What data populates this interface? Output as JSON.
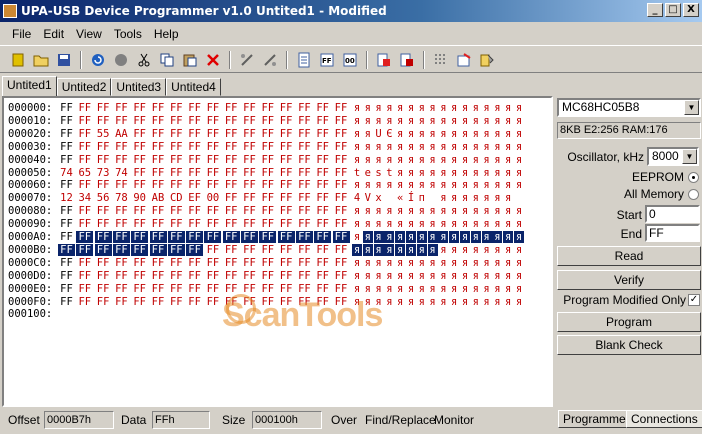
{
  "window": {
    "title": "UPA-USB Device Programmer v1.0  Untited1 - Modified",
    "min": "_",
    "max": "□",
    "close": "X"
  },
  "menu": [
    "File",
    "Edit",
    "View",
    "Tools",
    "Help"
  ],
  "tabs": [
    "Untited1",
    "Untited2",
    "Untited3",
    "Untited4"
  ],
  "editor": {
    "rows": [
      {
        "addr": "000000:",
        "bytes": [
          "FF",
          "FF",
          "FF",
          "FF",
          "FF",
          "FF",
          "FF",
          "FF",
          "FF",
          "FF",
          "FF",
          "FF",
          "FF",
          "FF",
          "FF",
          "FF"
        ],
        "chars": "яяяяяяяяяяяяяяяя"
      },
      {
        "addr": "000010:",
        "bytes": [
          "FF",
          "FF",
          "FF",
          "FF",
          "FF",
          "FF",
          "FF",
          "FF",
          "FF",
          "FF",
          "FF",
          "FF",
          "FF",
          "FF",
          "FF",
          "FF"
        ],
        "chars": "яяяяяяяяяяяяяяяя"
      },
      {
        "addr": "000020:",
        "bytes": [
          "FF",
          "FF",
          "55",
          "AA",
          "FF",
          "FF",
          "FF",
          "FF",
          "FF",
          "FF",
          "FF",
          "FF",
          "FF",
          "FF",
          "FF",
          "FF"
        ],
        "chars": "яяUЄяяяяяяяяяяяя"
      },
      {
        "addr": "000030:",
        "bytes": [
          "FF",
          "FF",
          "FF",
          "FF",
          "FF",
          "FF",
          "FF",
          "FF",
          "FF",
          "FF",
          "FF",
          "FF",
          "FF",
          "FF",
          "FF",
          "FF"
        ],
        "chars": "яяяяяяяяяяяяяяяя"
      },
      {
        "addr": "000040:",
        "bytes": [
          "FF",
          "FF",
          "FF",
          "FF",
          "FF",
          "FF",
          "FF",
          "FF",
          "FF",
          "FF",
          "FF",
          "FF",
          "FF",
          "FF",
          "FF",
          "FF"
        ],
        "chars": "яяяяяяяяяяяяяяяя"
      },
      {
        "addr": "000050:",
        "bytes": [
          "74",
          "65",
          "73",
          "74",
          "FF",
          "FF",
          "FF",
          "FF",
          "FF",
          "FF",
          "FF",
          "FF",
          "FF",
          "FF",
          "FF",
          "FF"
        ],
        "chars": "testяяяяяяяяяяяя"
      },
      {
        "addr": "000060:",
        "bytes": [
          "FF",
          "FF",
          "FF",
          "FF",
          "FF",
          "FF",
          "FF",
          "FF",
          "FF",
          "FF",
          "FF",
          "FF",
          "FF",
          "FF",
          "FF",
          "FF"
        ],
        "chars": "яяяяяяяяяяяяяяяя"
      },
      {
        "addr": "000070:",
        "bytes": [
          "12",
          "34",
          "56",
          "78",
          "90",
          "AB",
          "CD",
          "EF",
          "00",
          "FF",
          "FF",
          "FF",
          "FF",
          "FF",
          "FF",
          "FF"
        ],
        "chars": "4Vx«Íп яяяяяяя"
      },
      {
        "addr": "000080:",
        "bytes": [
          "FF",
          "FF",
          "FF",
          "FF",
          "FF",
          "FF",
          "FF",
          "FF",
          "FF",
          "FF",
          "FF",
          "FF",
          "FF",
          "FF",
          "FF",
          "FF"
        ],
        "chars": "яяяяяяяяяяяяяяяя"
      },
      {
        "addr": "000090:",
        "bytes": [
          "FF",
          "FF",
          "FF",
          "FF",
          "FF",
          "FF",
          "FF",
          "FF",
          "FF",
          "FF",
          "FF",
          "FF",
          "FF",
          "FF",
          "FF",
          "FF"
        ],
        "chars": "яяяяяяяяяяяяяяяя"
      },
      {
        "addr": "0000A0:",
        "bytes": [
          "FF",
          "FF",
          "FF",
          "FF",
          "FF",
          "FF",
          "FF",
          "FF",
          "FF",
          "FF",
          "FF",
          "FF",
          "FF",
          "FF",
          "FF",
          "FF"
        ],
        "chars": "яяяяяяяяяяяяяяяя"
      },
      {
        "addr": "0000B0:",
        "bytes": [
          "FF",
          "FF",
          "FF",
          "FF",
          "FF",
          "FF",
          "FF",
          "FF",
          "FF",
          "FF",
          "FF",
          "FF",
          "FF",
          "FF",
          "FF",
          "FF"
        ],
        "chars": "яяяяяяяяяяяяяяяя"
      },
      {
        "addr": "0000C0:",
        "bytes": [
          "FF",
          "FF",
          "FF",
          "FF",
          "FF",
          "FF",
          "FF",
          "FF",
          "FF",
          "FF",
          "FF",
          "FF",
          "FF",
          "FF",
          "FF",
          "FF"
        ],
        "chars": "яяяяяяяяяяяяяяяя"
      },
      {
        "addr": "0000D0:",
        "bytes": [
          "FF",
          "FF",
          "FF",
          "FF",
          "FF",
          "FF",
          "FF",
          "FF",
          "FF",
          "FF",
          "FF",
          "FF",
          "FF",
          "FF",
          "FF",
          "FF"
        ],
        "chars": "яяяяяяяяяяяяяяяя"
      },
      {
        "addr": "0000E0:",
        "bytes": [
          "FF",
          "FF",
          "FF",
          "FF",
          "FF",
          "FF",
          "FF",
          "FF",
          "FF",
          "FF",
          "FF",
          "FF",
          "FF",
          "FF",
          "FF",
          "FF"
        ],
        "chars": "яяяяяяяяяяяяяяяя"
      },
      {
        "addr": "0000F0:",
        "bytes": [
          "FF",
          "FF",
          "FF",
          "FF",
          "FF",
          "FF",
          "FF",
          "FF",
          "FF",
          "FF",
          "FF",
          "FF",
          "FF",
          "FF",
          "FF",
          "FF"
        ],
        "chars": "яяяяяяяяяяяяяяяя"
      },
      {
        "addr": "000100:",
        "bytes": [],
        "chars": ""
      }
    ],
    "selection": {
      "start": "0000A1",
      "end": "0000B7"
    },
    "colors": {
      "modified": "#c00000",
      "normal": "#000000",
      "selection": "#0a246a",
      "selection_text": "#ffffff"
    },
    "watermark": "ScanTools"
  },
  "side": {
    "device": "MC68HC05B8",
    "info": "8KB E2:256 RAM:176",
    "oscillator_label": "Oscillator, kHz",
    "oscillator_value": "8000",
    "eeprom_label": "EEPROM",
    "allmem_label": "All Memory",
    "start_label": "Start",
    "start_value": "0",
    "end_label": "End",
    "end_value": "FF",
    "read": "Read",
    "verify": "Verify",
    "prog_mod_label": "Program Modified Only",
    "program": "Program",
    "blank": "Blank Check"
  },
  "status": {
    "offset_label": "Offset",
    "offset_value": "0000B7h",
    "data_label": "Data",
    "data_value": "FFh",
    "size_label": "Size",
    "size_value": "000100h",
    "over": "Over",
    "findreplace": "Find/Replace",
    "monitor": "Monitor",
    "tab_programmer": "Programmer",
    "tab_connections": "Connections"
  },
  "toolbar_icons": [
    "chip-icon",
    "open-folder-icon",
    "save-icon",
    "refresh-icon",
    "stop-icon",
    "cut-icon",
    "copy-icon",
    "paste-icon",
    "delete-icon",
    "tool1-icon",
    "tool2-icon",
    "page-icon",
    "ff-icon",
    "00-icon",
    "fill1-icon",
    "fill2-icon",
    "grid-icon",
    "settings-icon",
    "config-icon"
  ]
}
